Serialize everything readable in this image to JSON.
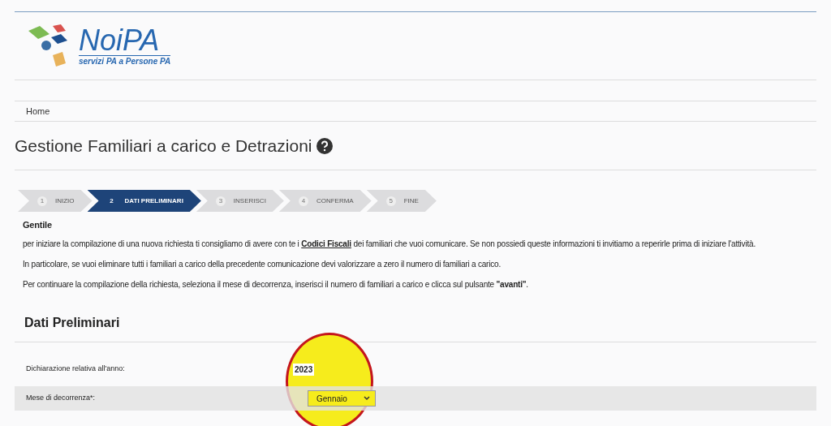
{
  "logo": {
    "name": "NoiPA",
    "tagline": "servizi PA a Persone PA"
  },
  "breadcrumb": [
    "Home"
  ],
  "title": "Gestione Familiari a carico e Detrazioni",
  "steps": [
    {
      "number": "1",
      "label": "INIZIO",
      "selected": false
    },
    {
      "number": "2",
      "label": "DATI PRELIMINARI",
      "selected": true
    },
    {
      "number": "3",
      "label": "INSERISCI",
      "selected": false
    },
    {
      "number": "4",
      "label": "CONFERMA",
      "selected": false
    },
    {
      "number": "5",
      "label": "FINE",
      "selected": false
    }
  ],
  "greeting": "Gentile",
  "intro": {
    "before": "per iniziare la compilazione di una nuova richiesta ti consigliamo di avere con te i",
    "link": "Codici Fiscali",
    "after": "dei familiari che vuoi comunicare. Se non possiedi queste informazioni ti invitiamo a reperirle prima di iniziare l'attività."
  },
  "paragraphs": [
    "In particolare, se vuoi eliminare tutti i familiari a carico della precedente comunicazione devi valorizzare a zero il numero di familiari a carico.",
    "Per continuare la compilazione della richiesta, seleziona il mese di decorrenza, inserisci il numero di familiari a carico e clicca sul pulsante **\"avanti\"**."
  ],
  "section_title": "Dati Preliminari",
  "fields": [
    {
      "kind": "text",
      "label": "Dichiarazione relativa all'anno:",
      "value": "2023"
    },
    {
      "kind": "select",
      "label": "Mese di decorrenza*:",
      "value": "Gennaio"
    }
  ]
}
